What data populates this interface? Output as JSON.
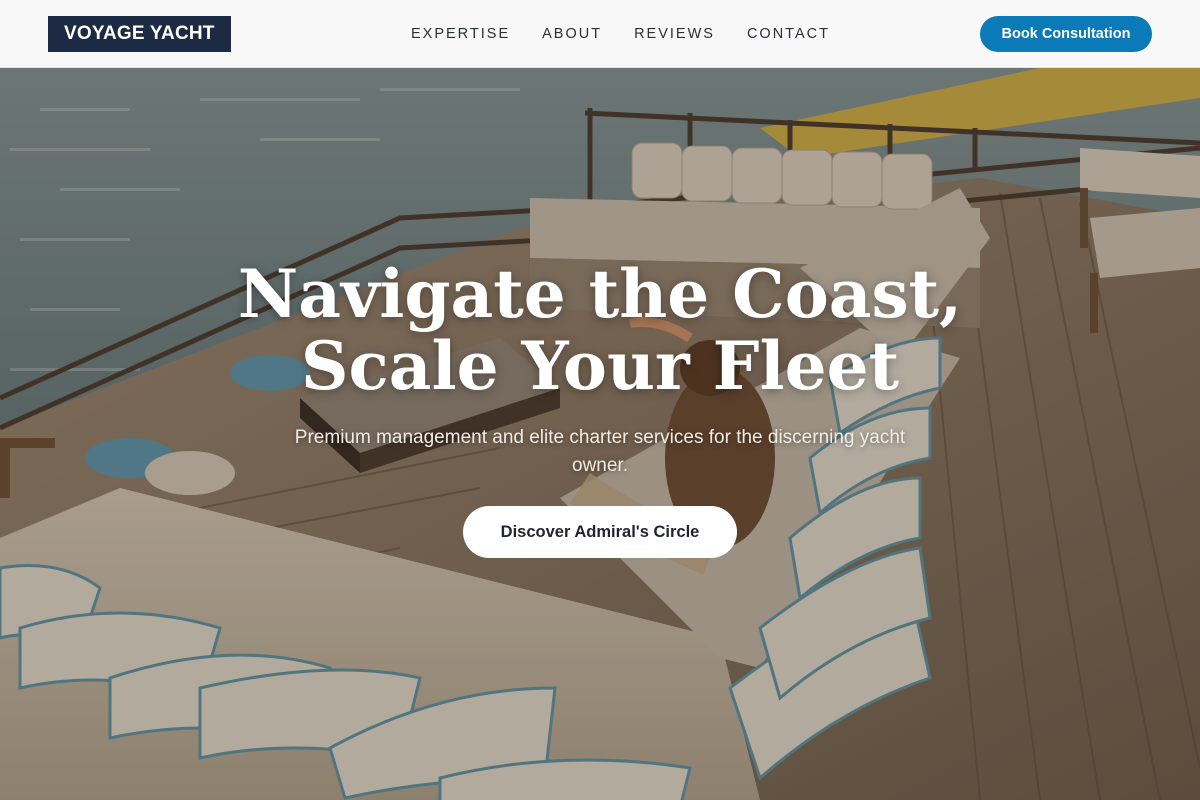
{
  "header": {
    "logo": "VOYAGE YACHT",
    "nav": [
      "EXPERTISE",
      "ABOUT",
      "REVIEWS",
      "CONTACT"
    ],
    "cta_label": "Book Consultation"
  },
  "hero": {
    "headline_line1": "Navigate the Coast,",
    "headline_line2": "Scale Your Fleet",
    "subtitle": "Premium management and elite charter services for the discerning yacht owner.",
    "button_label": "Discover Admiral's Circle"
  },
  "colors": {
    "logo_bg": "#1d2a44",
    "cta_bg": "#0a7bb8",
    "deck_wood": "#8a7560",
    "sea": "#5d6e70"
  }
}
